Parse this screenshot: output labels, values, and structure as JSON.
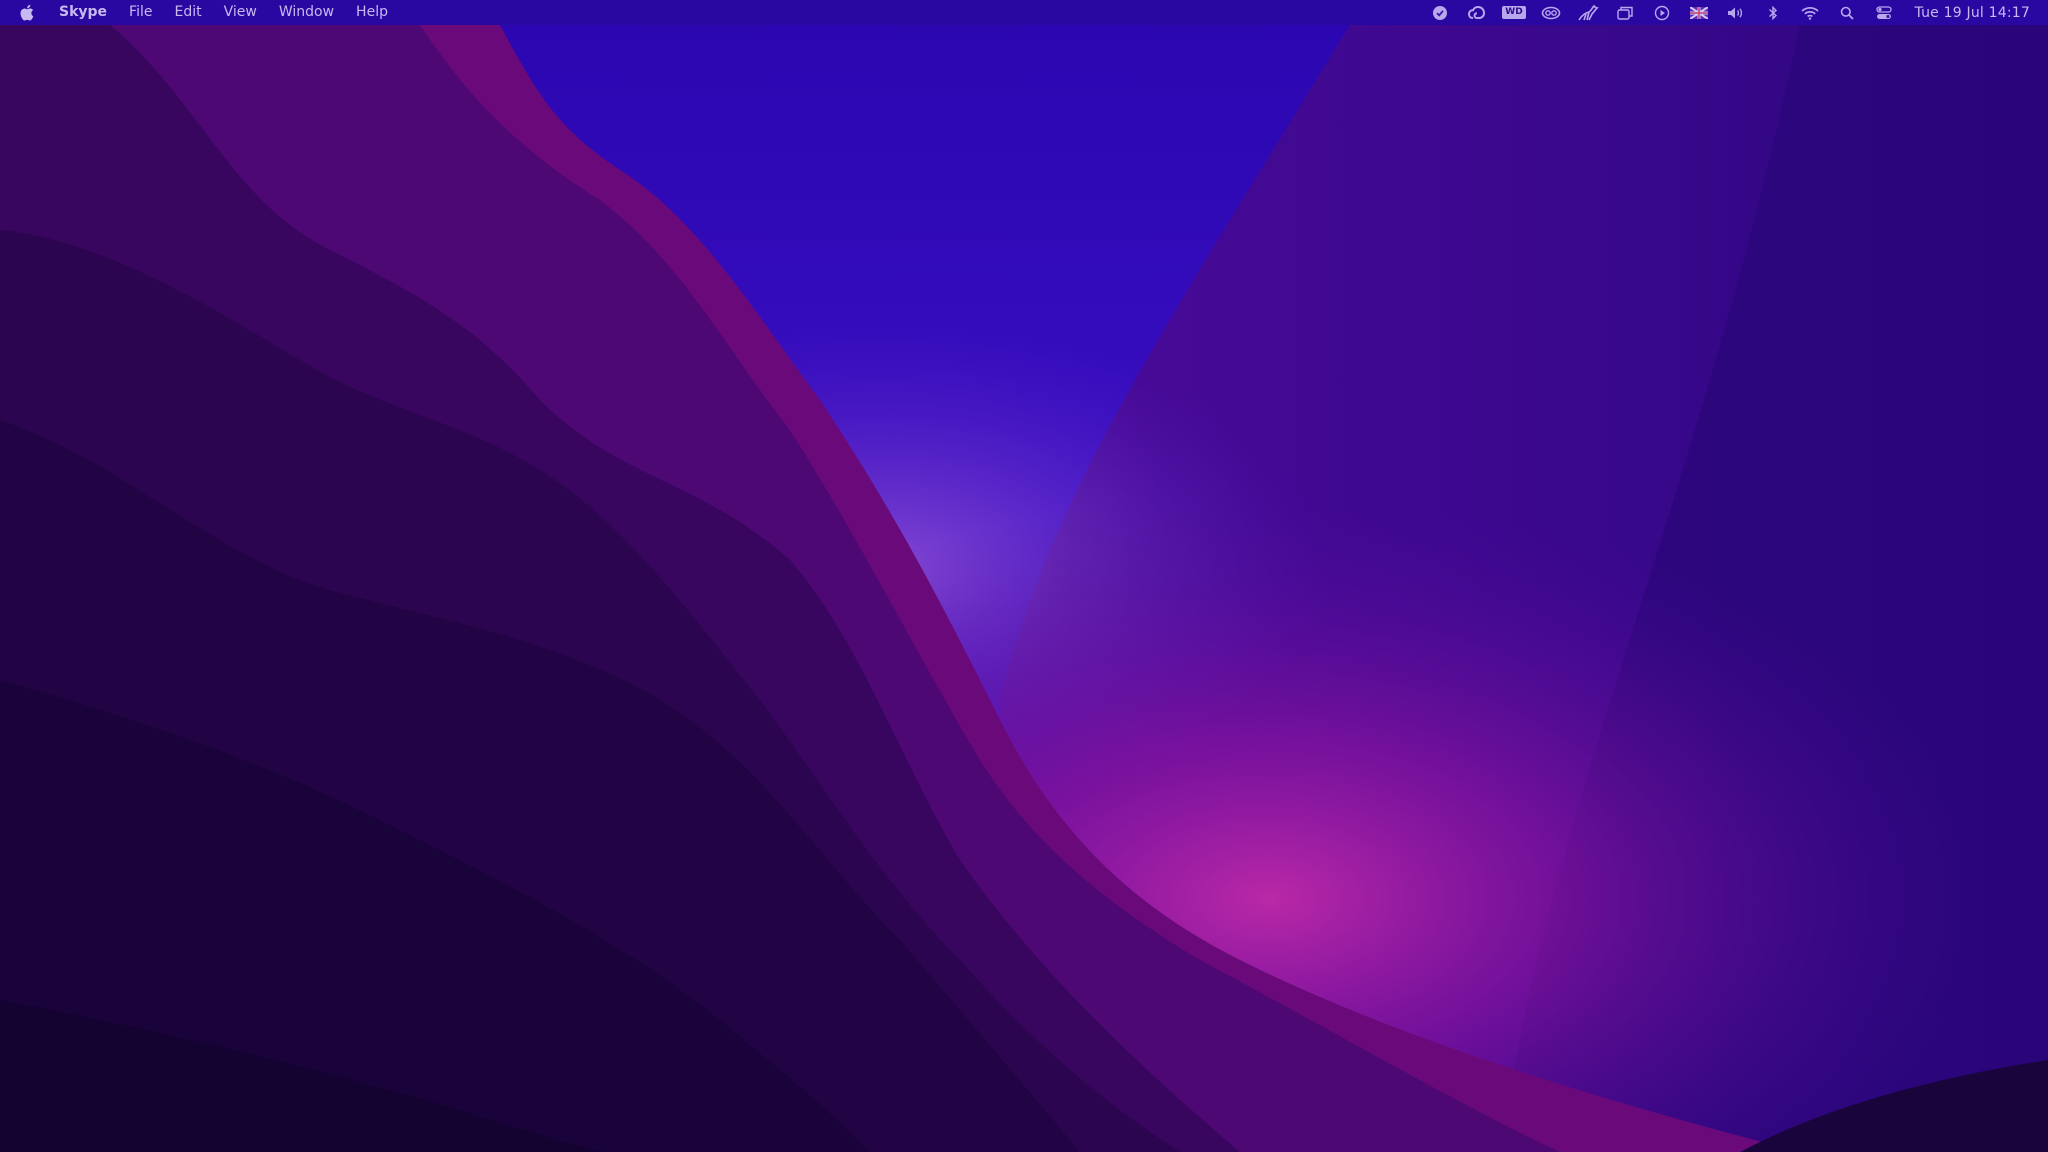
{
  "menubar": {
    "app_name": "Skype",
    "menus": [
      {
        "label": "File"
      },
      {
        "label": "Edit"
      },
      {
        "label": "View"
      },
      {
        "label": "Window"
      },
      {
        "label": "Help"
      }
    ],
    "status_icons": [
      "skype-status-icon",
      "creative-cloud-icon",
      "wd-drive-icon",
      "cc-icon",
      "kangaroo-icon",
      "window-stack-icon",
      "play-circle-icon",
      "uk-flag-icon",
      "volume-icon",
      "bluetooth-icon",
      "wifi-icon",
      "spotlight-search-icon",
      "control-center-icon"
    ],
    "wd_label": "WD",
    "clock": "Tue 19 Jul  14:17"
  },
  "colors": {
    "menubar_text": "#c7b9f2",
    "wallpaper_sky": "#3a10c8",
    "wallpaper_glow": "#b0209a",
    "wallpaper_dark": "#140330"
  }
}
